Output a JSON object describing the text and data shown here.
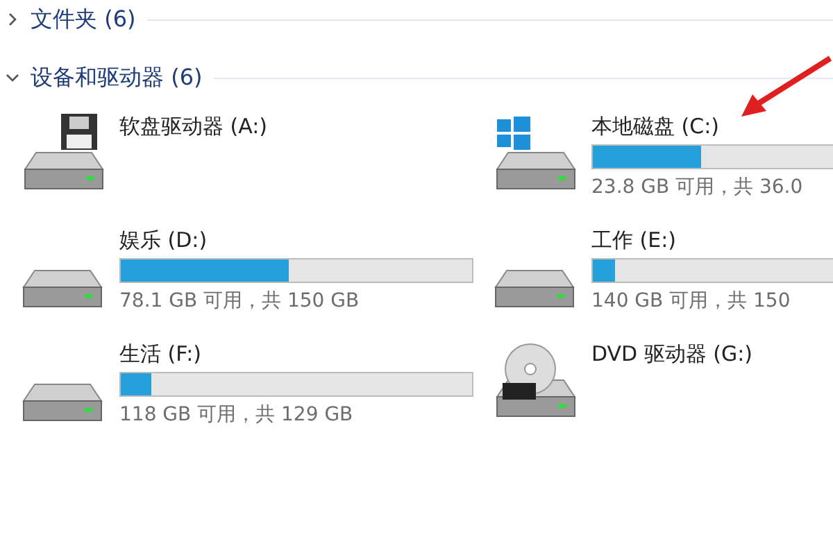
{
  "groups": [
    {
      "label": "文件夹 (6)",
      "expanded": false
    },
    {
      "label": "设备和驱动器 (6)",
      "expanded": true
    }
  ],
  "drives": [
    {
      "kind": "floppy",
      "name": "软盘驱动器 (A:)"
    },
    {
      "kind": "system",
      "name": "本地磁盘 (C:)",
      "level": 0.34,
      "space": "23.8 GB 可用，共 36.0"
    },
    {
      "kind": "disk",
      "name": "娱乐 (D:)",
      "level": 0.48,
      "space": "78.1 GB 可用，共 150 GB"
    },
    {
      "kind": "disk",
      "name": "工作 (E:)",
      "level": 0.07,
      "space": "140 GB 可用，共 150"
    },
    {
      "kind": "disk",
      "name": "生活 (F:)",
      "level": 0.085,
      "space": "118 GB 可用，共 129 GB"
    },
    {
      "kind": "dvd",
      "name": "DVD 驱动器 (G:)"
    }
  ]
}
